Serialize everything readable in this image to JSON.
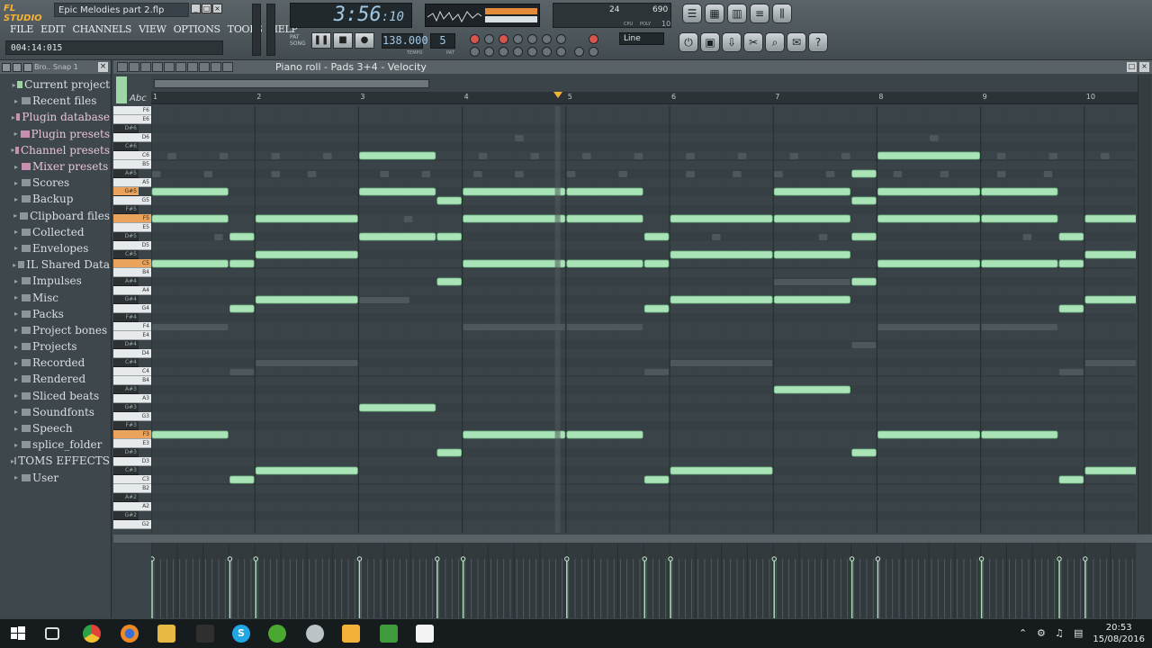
{
  "app": {
    "logo": "FL STUDIO",
    "document_title": "Epic Melodies part 2.flp",
    "hint_text": "004:14:015"
  },
  "menu": [
    "FILE",
    "EDIT",
    "CHANNELS",
    "VIEW",
    "OPTIONS",
    "TOOLS",
    "HELP"
  ],
  "transport": {
    "time": "3:56",
    "time_sub": ":10",
    "tempo": "138.000",
    "pattern": "5",
    "tempo_caption": "TEMPO",
    "pattern_caption": "PAT",
    "pat_label": "PAT",
    "song_label": "SONG"
  },
  "cpu": {
    "value_a": "24",
    "value_b": "690",
    "cpu_label": "CPU",
    "poly_label": "POLY",
    "poly_value": "10"
  },
  "snap": {
    "value": "Line"
  },
  "browser": {
    "snap_label": "Bro.. Snap 1",
    "items": [
      {
        "label": "Current project",
        "expander": "▸"
      },
      {
        "label": "Recent files",
        "expander": "▸"
      },
      {
        "label": "Plugin database",
        "expander": "▸"
      },
      {
        "label": "Plugin presets",
        "expander": "▸"
      },
      {
        "label": "Channel presets",
        "expander": "▸"
      },
      {
        "label": "Mixer presets",
        "expander": "▸"
      },
      {
        "label": "Scores",
        "expander": "▸"
      },
      {
        "label": "Backup",
        "expander": "▸"
      },
      {
        "label": "Clipboard files",
        "expander": "▸"
      },
      {
        "label": "Collected",
        "expander": "▸"
      },
      {
        "label": "Envelopes",
        "expander": "▸"
      },
      {
        "label": "IL Shared Data",
        "expander": "▸"
      },
      {
        "label": "Impulses",
        "expander": "▸"
      },
      {
        "label": "Misc",
        "expander": "▸"
      },
      {
        "label": "Packs",
        "expander": "▸"
      },
      {
        "label": "Project bones",
        "expander": "▸"
      },
      {
        "label": "Projects",
        "expander": "▸"
      },
      {
        "label": "Recorded",
        "expander": "▸"
      },
      {
        "label": "Rendered",
        "expander": "▸"
      },
      {
        "label": "Sliced beats",
        "expander": "▸"
      },
      {
        "label": "Soundfonts",
        "expander": "▸"
      },
      {
        "label": "Speech",
        "expander": "▸"
      },
      {
        "label": "splice_folder",
        "expander": "▸"
      },
      {
        "label": "TOMS EFFECTS",
        "expander": "▸"
      },
      {
        "label": "User",
        "expander": "▸"
      }
    ]
  },
  "piano_roll": {
    "title": "Piano roll - Pads 3+4",
    "event": "Velocity",
    "abc_label": "Abc",
    "bars": [
      "1",
      "2",
      "3",
      "4",
      "5",
      "6",
      "7",
      "8",
      "9",
      "10"
    ],
    "playhead_bar": 4.92,
    "keys": [
      "F6",
      "E6",
      "D#6",
      "D6",
      "C#6",
      "C6",
      "B5",
      "A#5",
      "A5",
      "G#5",
      "G5",
      "F#5",
      "F5",
      "E5",
      "D#5",
      "D5",
      "C#5",
      "C5",
      "B4",
      "A#4",
      "A4",
      "G#4",
      "G4",
      "F#4",
      "F4",
      "E4",
      "D#4",
      "D4",
      "C#4",
      "C4",
      "B4",
      "A#3",
      "A3",
      "G#3",
      "G3",
      "F#3",
      "F3",
      "E3",
      "D#3",
      "D3",
      "C#3",
      "C3",
      "B2",
      "A#2",
      "A2",
      "G#2",
      "G2"
    ],
    "highlight_keys": [
      "G#5",
      "F5",
      "C5",
      "F3"
    ],
    "notes": [
      {
        "key": "G#5",
        "start": 1.0,
        "len": 0.75
      },
      {
        "key": "F5",
        "start": 1.0,
        "len": 0.75
      },
      {
        "key": "C5",
        "start": 1.0,
        "len": 0.75
      },
      {
        "key": "F3",
        "start": 1.0,
        "len": 0.75
      },
      {
        "key": "D#5",
        "start": 1.75,
        "len": 0.25
      },
      {
        "key": "C5",
        "start": 1.75,
        "len": 0.25
      },
      {
        "key": "G4",
        "start": 1.75,
        "len": 0.25
      },
      {
        "key": "C3",
        "start": 1.75,
        "len": 0.25
      },
      {
        "key": "F5",
        "start": 2.0,
        "len": 1.0
      },
      {
        "key": "C#5",
        "start": 2.0,
        "len": 1.0
      },
      {
        "key": "G#4",
        "start": 2.0,
        "len": 1.0
      },
      {
        "key": "C#3",
        "start": 2.0,
        "len": 1.0
      },
      {
        "key": "C6",
        "start": 3.0,
        "len": 0.75
      },
      {
        "key": "G#5",
        "start": 3.0,
        "len": 0.75
      },
      {
        "key": "D#5",
        "start": 3.0,
        "len": 0.75
      },
      {
        "key": "G#3",
        "start": 3.0,
        "len": 0.75
      },
      {
        "key": "G5",
        "start": 3.75,
        "len": 0.25
      },
      {
        "key": "D#5",
        "start": 3.75,
        "len": 0.25
      },
      {
        "key": "A#4",
        "start": 3.75,
        "len": 0.25
      },
      {
        "key": "D#3",
        "start": 3.75,
        "len": 0.25
      },
      {
        "key": "G#5",
        "start": 4.0,
        "len": 1.0
      },
      {
        "key": "F5",
        "start": 4.0,
        "len": 1.0
      },
      {
        "key": "C5",
        "start": 4.0,
        "len": 1.0
      },
      {
        "key": "F3",
        "start": 4.0,
        "len": 1.0
      },
      {
        "key": "G#5",
        "start": 5.0,
        "len": 0.75
      },
      {
        "key": "F5",
        "start": 5.0,
        "len": 0.75
      },
      {
        "key": "C5",
        "start": 5.0,
        "len": 0.75
      },
      {
        "key": "F3",
        "start": 5.0,
        "len": 0.75
      },
      {
        "key": "D#5",
        "start": 5.75,
        "len": 0.25
      },
      {
        "key": "C5",
        "start": 5.75,
        "len": 0.25
      },
      {
        "key": "G4",
        "start": 5.75,
        "len": 0.25
      },
      {
        "key": "C3",
        "start": 5.75,
        "len": 0.25
      },
      {
        "key": "F5",
        "start": 6.0,
        "len": 1.0
      },
      {
        "key": "C#5",
        "start": 6.0,
        "len": 1.0
      },
      {
        "key": "G#4",
        "start": 6.0,
        "len": 1.0
      },
      {
        "key": "C#3",
        "start": 6.0,
        "len": 1.0
      },
      {
        "key": "G#5",
        "start": 7.0,
        "len": 0.75
      },
      {
        "key": "F5",
        "start": 7.0,
        "len": 0.75
      },
      {
        "key": "C#5",
        "start": 7.0,
        "len": 0.75
      },
      {
        "key": "G#4",
        "start": 7.0,
        "len": 0.75
      },
      {
        "key": "A#3",
        "start": 7.0,
        "len": 0.75
      },
      {
        "key": "A#5",
        "start": 7.75,
        "len": 0.25
      },
      {
        "key": "G5",
        "start": 7.75,
        "len": 0.25
      },
      {
        "key": "D#5",
        "start": 7.75,
        "len": 0.25
      },
      {
        "key": "A#4",
        "start": 7.75,
        "len": 0.25
      },
      {
        "key": "D#3",
        "start": 7.75,
        "len": 0.25
      },
      {
        "key": "C6",
        "start": 8.0,
        "len": 1.0
      },
      {
        "key": "G#5",
        "start": 8.0,
        "len": 1.0
      },
      {
        "key": "F5",
        "start": 8.0,
        "len": 1.0
      },
      {
        "key": "C5",
        "start": 8.0,
        "len": 1.0
      },
      {
        "key": "F3",
        "start": 8.0,
        "len": 1.0
      },
      {
        "key": "G#5",
        "start": 9.0,
        "len": 0.75
      },
      {
        "key": "F5",
        "start": 9.0,
        "len": 0.75
      },
      {
        "key": "C5",
        "start": 9.0,
        "len": 0.75
      },
      {
        "key": "F3",
        "start": 9.0,
        "len": 0.75
      },
      {
        "key": "D#5",
        "start": 9.75,
        "len": 0.25
      },
      {
        "key": "C5",
        "start": 9.75,
        "len": 0.25
      },
      {
        "key": "G4",
        "start": 9.75,
        "len": 0.25
      },
      {
        "key": "C3",
        "start": 9.75,
        "len": 0.25
      },
      {
        "key": "F5",
        "start": 10.0,
        "len": 0.6
      },
      {
        "key": "C#5",
        "start": 10.0,
        "len": 0.6
      },
      {
        "key": "G#4",
        "start": 10.0,
        "len": 0.6
      },
      {
        "key": "C#3",
        "start": 10.0,
        "len": 0.6
      }
    ],
    "ghost_notes": [
      {
        "key": "D6",
        "start": 4.5,
        "len": 0.1
      },
      {
        "key": "D6",
        "start": 8.5,
        "len": 0.1
      },
      {
        "key": "C6",
        "start": 1.15,
        "len": 0.1
      },
      {
        "key": "C6",
        "start": 1.65,
        "len": 0.1
      },
      {
        "key": "C6",
        "start": 2.15,
        "len": 0.1
      },
      {
        "key": "C6",
        "start": 2.65,
        "len": 0.1
      },
      {
        "key": "C6",
        "start": 4.15,
        "len": 0.1
      },
      {
        "key": "C6",
        "start": 4.65,
        "len": 0.1
      },
      {
        "key": "C6",
        "start": 5.15,
        "len": 0.1
      },
      {
        "key": "C6",
        "start": 5.65,
        "len": 0.1
      },
      {
        "key": "C6",
        "start": 6.15,
        "len": 0.1
      },
      {
        "key": "C6",
        "start": 6.65,
        "len": 0.1
      },
      {
        "key": "C6",
        "start": 7.15,
        "len": 0.1
      },
      {
        "key": "C6",
        "start": 7.65,
        "len": 0.1
      },
      {
        "key": "C6",
        "start": 9.15,
        "len": 0.1
      },
      {
        "key": "C6",
        "start": 9.65,
        "len": 0.1
      },
      {
        "key": "C6",
        "start": 10.15,
        "len": 0.1
      },
      {
        "key": "A#5",
        "start": 1.0,
        "len": 0.1
      },
      {
        "key": "A#5",
        "start": 1.5,
        "len": 0.1
      },
      {
        "key": "A#5",
        "start": 2.15,
        "len": 0.1
      },
      {
        "key": "A#5",
        "start": 2.5,
        "len": 0.1
      },
      {
        "key": "A#5",
        "start": 3.2,
        "len": 0.1
      },
      {
        "key": "A#5",
        "start": 3.6,
        "len": 0.1
      },
      {
        "key": "A#5",
        "start": 4.1,
        "len": 0.1
      },
      {
        "key": "A#5",
        "start": 4.5,
        "len": 0.1
      },
      {
        "key": "A#5",
        "start": 5.0,
        "len": 0.1
      },
      {
        "key": "A#5",
        "start": 5.5,
        "len": 0.1
      },
      {
        "key": "A#5",
        "start": 6.15,
        "len": 0.1
      },
      {
        "key": "A#5",
        "start": 6.6,
        "len": 0.1
      },
      {
        "key": "A#5",
        "start": 7.0,
        "len": 0.1
      },
      {
        "key": "A#5",
        "start": 7.5,
        "len": 0.1
      },
      {
        "key": "A#5",
        "start": 8.15,
        "len": 0.1
      },
      {
        "key": "A#5",
        "start": 8.6,
        "len": 0.1
      },
      {
        "key": "A#5",
        "start": 9.15,
        "len": 0.1
      },
      {
        "key": "A#5",
        "start": 9.6,
        "len": 0.1
      },
      {
        "key": "F5",
        "start": 3.43,
        "len": 0.1
      },
      {
        "key": "D#5",
        "start": 1.6,
        "len": 0.1
      },
      {
        "key": "D#5",
        "start": 3.65,
        "len": 0.1
      },
      {
        "key": "D#5",
        "start": 6.4,
        "len": 0.1
      },
      {
        "key": "D#5",
        "start": 7.43,
        "len": 0.1
      },
      {
        "key": "D#5",
        "start": 9.4,
        "len": 0.1
      },
      {
        "key": "A#4",
        "start": 7.0,
        "len": 0.75
      },
      {
        "key": "G#4",
        "start": 3.0,
        "len": 0.5
      },
      {
        "key": "F4",
        "start": 1.0,
        "len": 0.75
      },
      {
        "key": "F4",
        "start": 4.0,
        "len": 1.0
      },
      {
        "key": "F4",
        "start": 5.0,
        "len": 0.75
      },
      {
        "key": "F4",
        "start": 8.0,
        "len": 1.0
      },
      {
        "key": "F4",
        "start": 9.0,
        "len": 0.75
      },
      {
        "key": "D#4",
        "start": 7.75,
        "len": 0.25
      },
      {
        "key": "C#4",
        "start": 2.0,
        "len": 1.0
      },
      {
        "key": "C#4",
        "start": 6.0,
        "len": 1.0
      },
      {
        "key": "C#4",
        "start": 10.0,
        "len": 0.6
      },
      {
        "key": "C4",
        "start": 1.75,
        "len": 0.25
      },
      {
        "key": "C4",
        "start": 5.75,
        "len": 0.25
      },
      {
        "key": "C4",
        "start": 9.75,
        "len": 0.25
      }
    ]
  },
  "taskbar": {
    "clock_time": "20:53",
    "clock_date": "15/08/2016"
  }
}
